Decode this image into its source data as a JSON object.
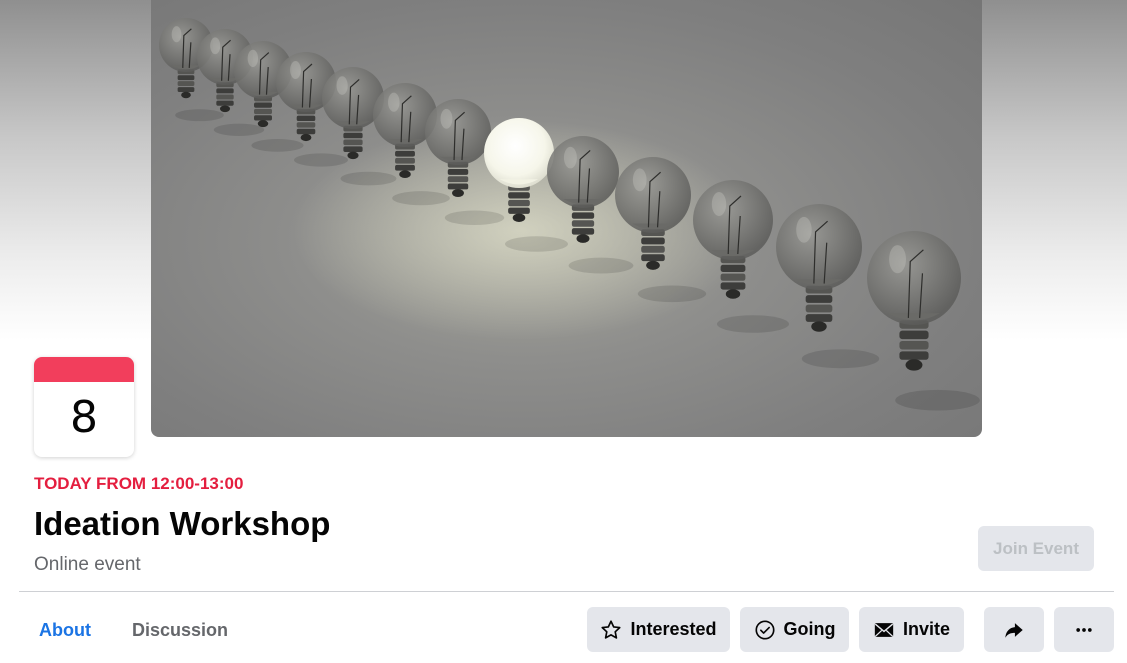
{
  "event": {
    "date_day": "8",
    "when": "TODAY FROM 12:00-13:00",
    "title": "Ideation Workshop",
    "subtitle": "Online event",
    "join_label": "Join Event"
  },
  "tabs": [
    {
      "label": "About",
      "active": true
    },
    {
      "label": "Discussion",
      "active": false
    }
  ],
  "actions": {
    "interested": {
      "label": "Interested",
      "icon": "star-outline-icon"
    },
    "going": {
      "label": "Going",
      "icon": "check-circle-icon"
    },
    "invite": {
      "label": "Invite",
      "icon": "envelope-icon"
    },
    "share": {
      "icon": "share-arrow-icon"
    },
    "more": {
      "icon": "more-dots-icon"
    }
  },
  "colors": {
    "accent_blue": "#1b74e4",
    "date_red": "#e41e3f",
    "calendar_strip": "#f23e5c",
    "button_gray": "#e4e6eb"
  }
}
